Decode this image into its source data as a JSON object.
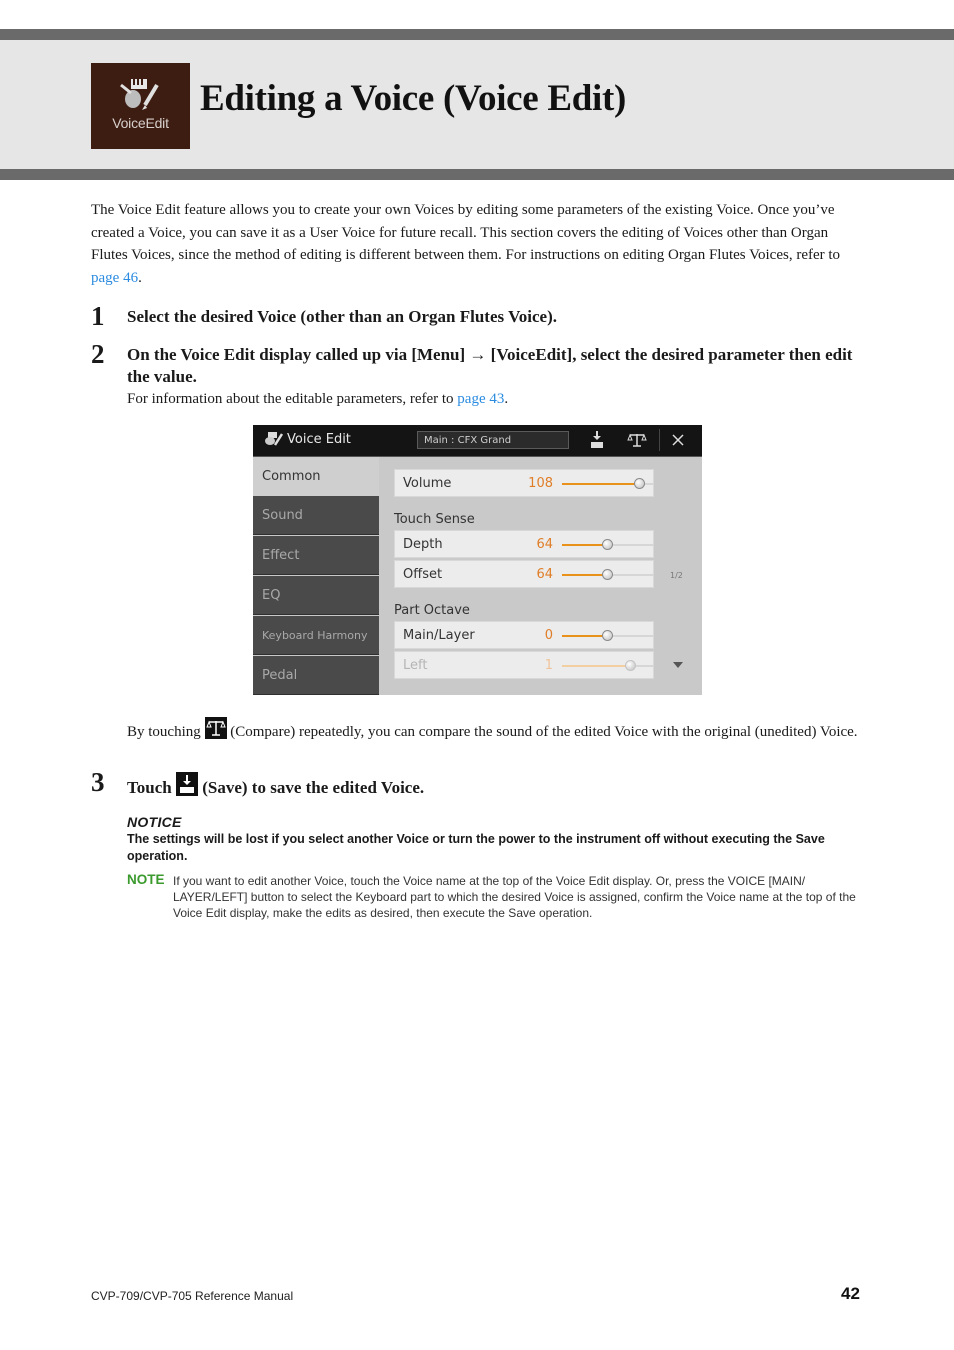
{
  "header": {
    "chapter_icon_label": "VoiceEdit",
    "title": "Editing a Voice (Voice Edit)"
  },
  "intro": {
    "text": "The Voice Edit feature allows you to create your own Voices by editing some parameters of the existing Voice. Once you’ve created a Voice, you can save it as a User Voice for future recall. This section covers the editing of Voices other than Organ Flutes Voices, since the method of editing is different between them. For instructions on editing Organ Flutes Voices, refer to ",
    "link": "page 46",
    "end": "."
  },
  "steps": [
    {
      "number": "1",
      "text": "Select the desired Voice (other than an Organ Flutes Voice)."
    },
    {
      "number": "2",
      "text": "On the Voice Edit display called up via [Menu] → [VoiceEdit], select the desired parameter then edit the value.",
      "sub_text": "For information about the editable parameters, refer to ",
      "sub_link": "page 43",
      "sub_end": "."
    },
    {
      "number": "3",
      "text_before": "Touch",
      "text_after": "(Save) to save the edited Voice."
    }
  ],
  "screen": {
    "title": "Voice Edit",
    "voice_name": "Main  : CFX Grand",
    "buttons": [
      "save-icon",
      "compare-icon",
      "close-icon"
    ],
    "nav": [
      {
        "label": "Common",
        "active": true
      },
      {
        "label": "Sound",
        "active": false
      },
      {
        "label": "Effect",
        "active": false
      },
      {
        "label": "EQ",
        "active": false
      },
      {
        "label": "Keyboard Harmony",
        "active": false
      },
      {
        "label": "Pedal",
        "active": false
      }
    ],
    "sections": {
      "touch_sense": "Touch Sense",
      "part_octave": "Part Octave"
    },
    "params": [
      {
        "name": "Volume",
        "value": "108",
        "slider_fraction": 0.85,
        "enabled": true
      },
      {
        "name": "Depth",
        "value": "64",
        "slider_fraction": 0.5,
        "enabled": true
      },
      {
        "name": "Offset",
        "value": "64",
        "slider_fraction": 0.5,
        "enabled": true
      },
      {
        "name": "Main/Layer",
        "value": "0",
        "slider_fraction": 0.5,
        "enabled": true
      },
      {
        "name": "Left",
        "value": "1",
        "slider_fraction": 0.75,
        "enabled": false
      }
    ],
    "page_indicator": "1/2"
  },
  "compare": {
    "before": "By touching",
    "after": "(Compare) repeatedly, you can compare the sound of the edited Voice with the original (unedited) Voice."
  },
  "notice": {
    "title": "NOTICE",
    "text": "The settings will be lost if you select another Voice or turn the power to the instrument off without executing the Save operation."
  },
  "note": {
    "label": "NOTE",
    "text": "If you want to edit another Voice, touch the Voice name at the top of the Voice Edit display. Or, press the VOICE [MAIN/ LAYER/LEFT] button to select the Keyboard part to which the desired Voice is assigned, confirm the Voice name at the top of the Voice Edit display, make the edits as desired, then execute the Save operation."
  },
  "footer": {
    "manual": "CVP-709/CVP-705 Reference Manual",
    "page": "42"
  },
  "colors": {
    "link": "#2a8be0",
    "note_green": "#3b9a2d",
    "value_orange": "#e07e28",
    "chapter_icon_bg": "#3d1d12"
  }
}
